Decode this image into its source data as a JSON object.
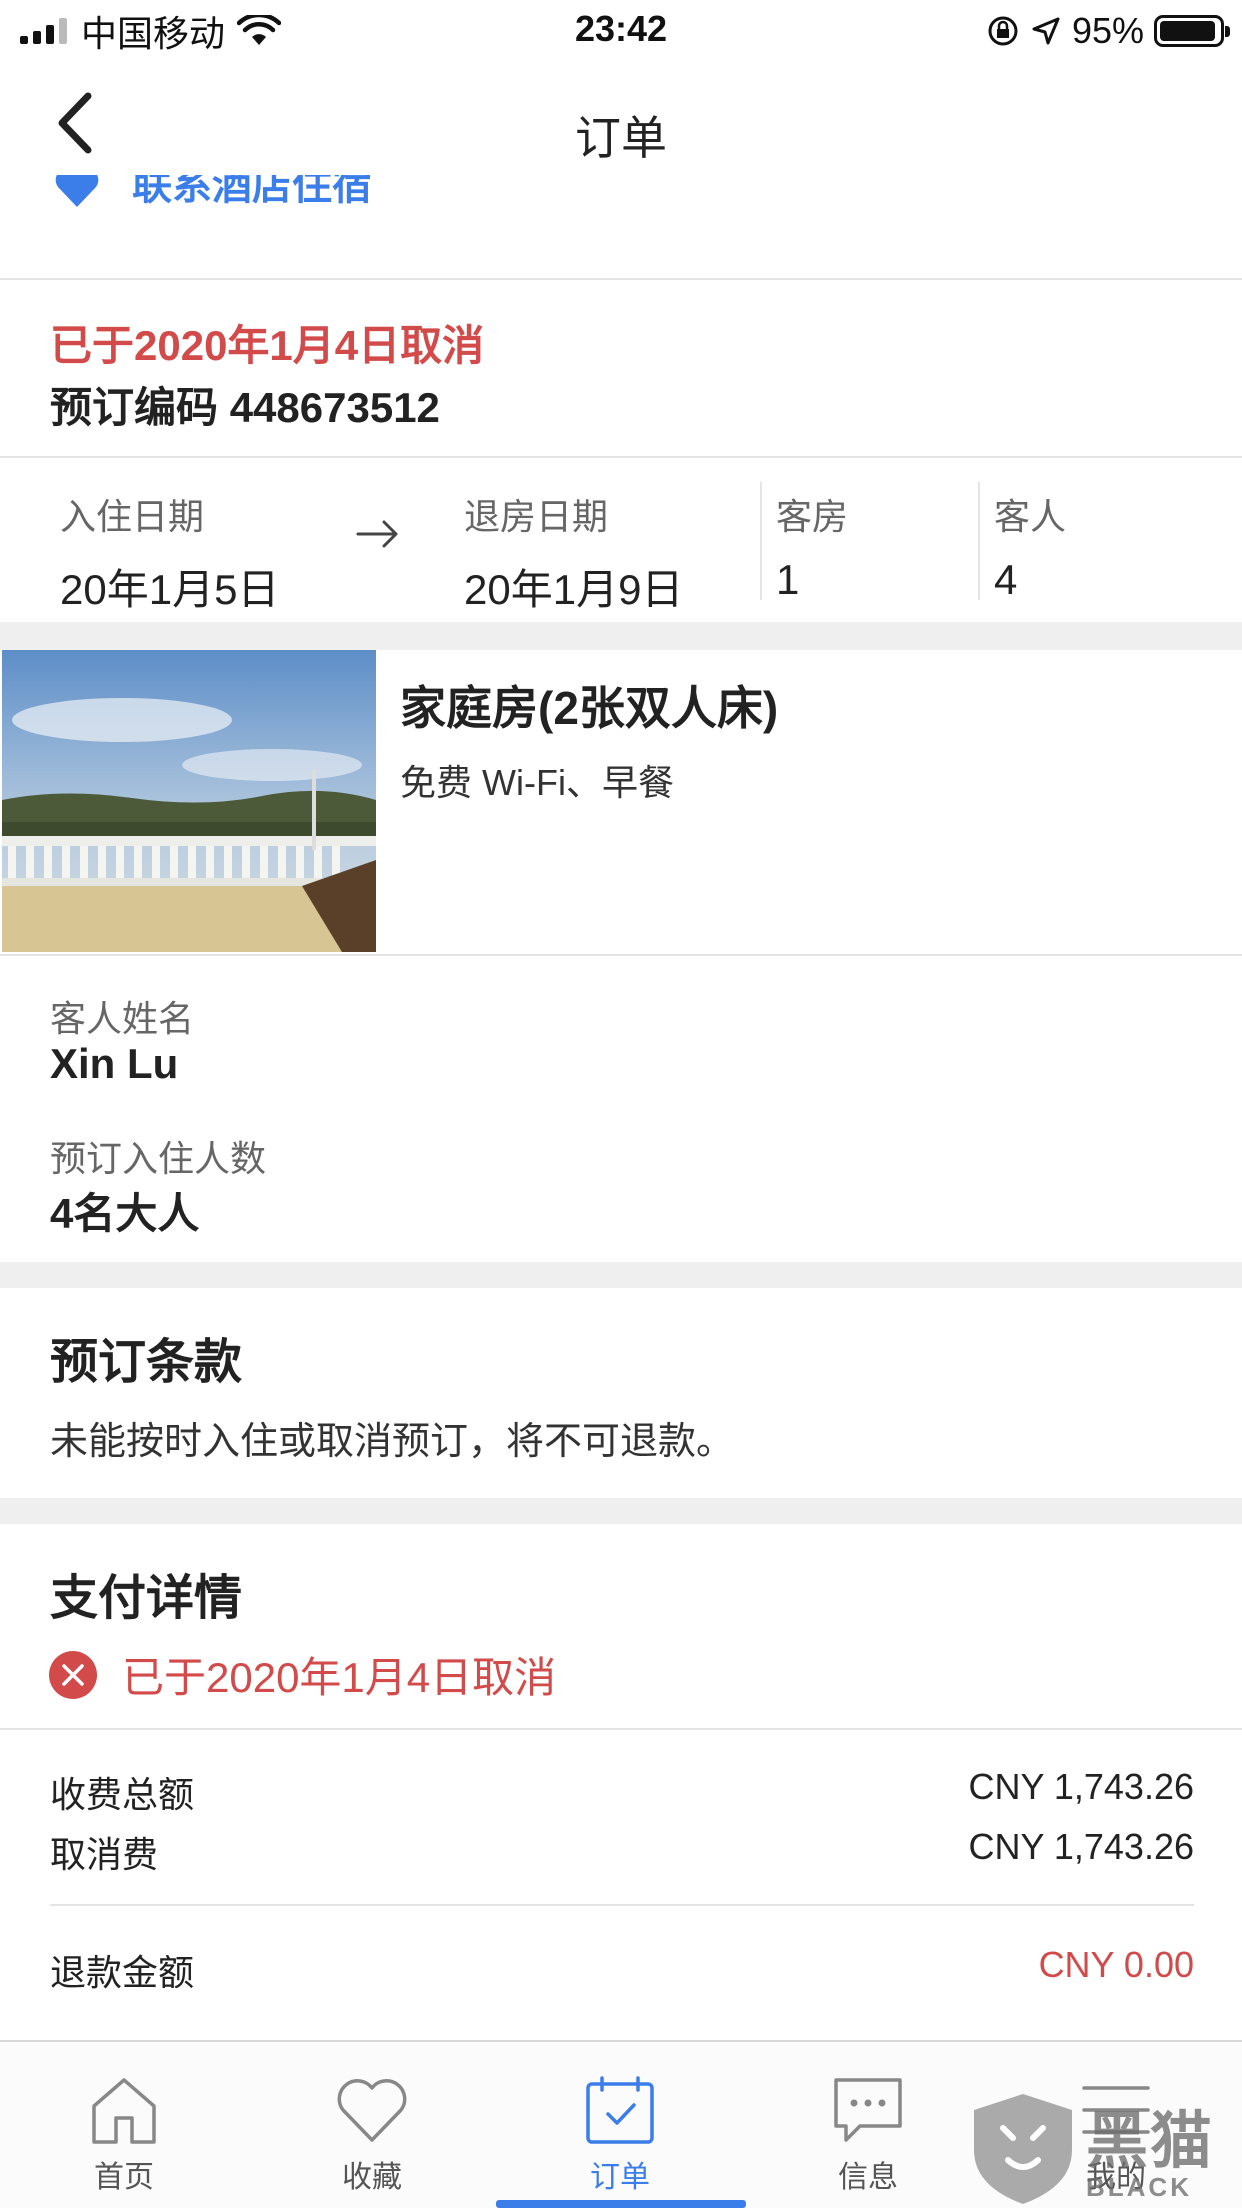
{
  "status_bar": {
    "carrier": "中国移动",
    "time": "23:42",
    "battery": "95%",
    "battery_level": 0.95
  },
  "nav": {
    "title": "订单"
  },
  "partial_link": {
    "label": "联系酒店住宿"
  },
  "booking": {
    "cancel_status": "已于2020年1月4日取消",
    "code_label": "预订编码",
    "code": "448673512"
  },
  "dates": {
    "checkin_label": "入住日期",
    "checkin_value": "20年1月5日",
    "checkout_label": "退房日期",
    "checkout_value": "20年1月9日",
    "rooms_label": "客房",
    "rooms_value": "1",
    "guests_label": "客人",
    "guests_value": "4"
  },
  "room": {
    "name": "家庭房(2张双人床)",
    "amenities": "免费 Wi-Fi、早餐"
  },
  "guest": {
    "name_label": "客人姓名",
    "name_value": "Xin Lu",
    "count_label": "预订入住人数",
    "count_value": "4名大人"
  },
  "terms": {
    "title": "预订条款",
    "text": "未能按时入住或取消预订，将不可退款。"
  },
  "payment": {
    "title": "支付详情",
    "status": "已于2020年1月4日取消",
    "total_label": "收费总额",
    "total_value": "CNY 1,743.26",
    "fee_label": "取消费",
    "fee_value": "CNY 1,743.26",
    "refund_label": "退款金额",
    "refund_value": "CNY 0.00"
  },
  "tabs": [
    {
      "label": "首页",
      "icon": "home-icon"
    },
    {
      "label": "收藏",
      "icon": "heart-icon"
    },
    {
      "label": "订单",
      "icon": "calendar-check-icon",
      "active": true
    },
    {
      "label": "信息",
      "icon": "chat-icon"
    },
    {
      "label": "我的",
      "icon": "menu-icon"
    }
  ],
  "watermark": {
    "text": "黑猫",
    "subtext": "BLACK CAT"
  },
  "colors": {
    "accent": "#3b7de9",
    "alert": "#d24a4a",
    "gap": "#efefef"
  }
}
